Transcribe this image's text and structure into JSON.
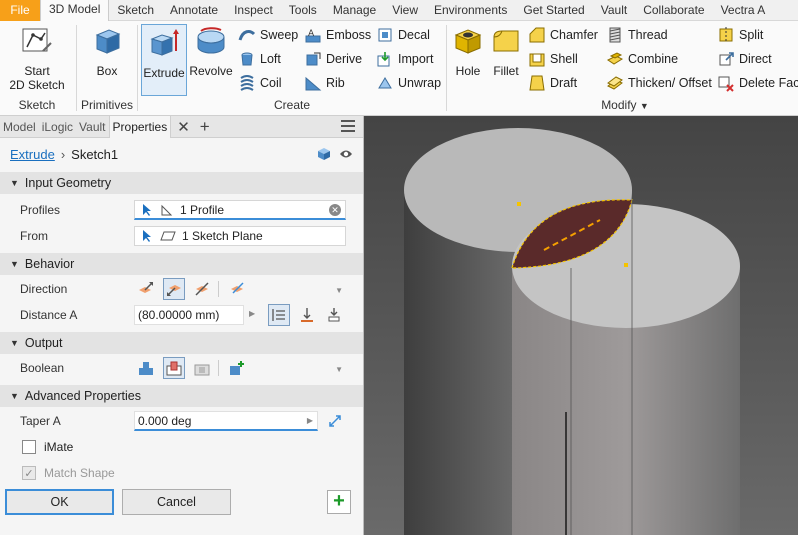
{
  "menu": {
    "tabs": [
      "File",
      "3D Model",
      "Sketch",
      "Annotate",
      "Inspect",
      "Tools",
      "Manage",
      "View",
      "Environments",
      "Get Started",
      "Vault",
      "Collaborate",
      "Vectra A"
    ]
  },
  "ribbon": {
    "sketch": {
      "start_label_1": "Start",
      "start_label_2": "2D Sketch",
      "group": "Sketch"
    },
    "primitives": {
      "box": "Box",
      "group": "Primitives"
    },
    "create": {
      "extrude": "Extrude",
      "revolve": "Revolve",
      "sweep": "Sweep",
      "emboss": "Emboss",
      "decal": "Decal",
      "loft": "Loft",
      "derive": "Derive",
      "import": "Import",
      "coil": "Coil",
      "rib": "Rib",
      "unwrap": "Unwrap",
      "group": "Create"
    },
    "modify": {
      "hole": "Hole",
      "fillet": "Fillet",
      "chamfer": "Chamfer",
      "thread": "Thread",
      "split": "Split",
      "shell": "Shell",
      "combine": "Combine",
      "direct": "Direct",
      "draft": "Draft",
      "thicken": "Thicken/ Offset",
      "delete_face": "Delete Face",
      "group": "Modify"
    }
  },
  "panel": {
    "tabs": [
      "Model",
      "iLogic",
      "Vault",
      "Properties"
    ],
    "close": "✕",
    "add": "+",
    "breadcrumb": {
      "feature": "Extrude",
      "sketch": "Sketch1"
    },
    "input_geometry": {
      "title": "Input Geometry",
      "profiles_label": "Profiles",
      "profiles_value": "1 Profile",
      "from_label": "From",
      "from_value": "1 Sketch Plane"
    },
    "behavior": {
      "title": "Behavior",
      "direction_label": "Direction",
      "distance_label": "Distance A",
      "distance_value": "(80.00000 mm)"
    },
    "output": {
      "title": "Output",
      "boolean_label": "Boolean"
    },
    "advanced": {
      "title": "Advanced Properties",
      "taper_label": "Taper A",
      "taper_value": "0.000 deg",
      "imate_label": "iMate",
      "match_shape_label": "Match Shape"
    },
    "buttons": {
      "ok": "OK",
      "cancel": "Cancel",
      "add": "+"
    }
  },
  "colors": {
    "accent": "#3b8dd8",
    "file_tab": "#f7a019",
    "preview": "#f5c400",
    "profile_fill": "#5a2a2a"
  }
}
